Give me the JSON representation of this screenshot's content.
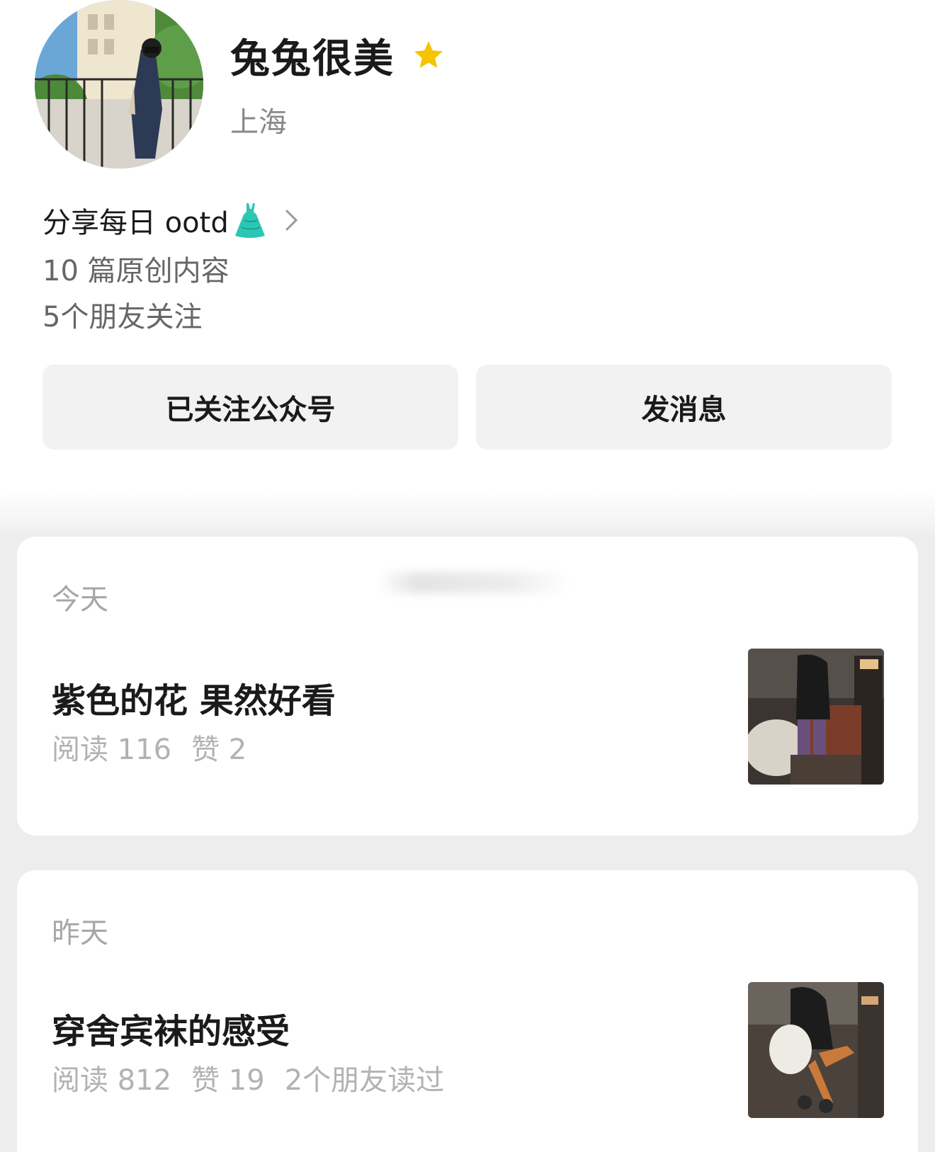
{
  "profile": {
    "name": "兔兔很美",
    "badge_icon": "star-icon",
    "location": "上海",
    "bio": "分享每日 ootd",
    "bio_emoji_icon": "dress-icon",
    "posts_count": "10 篇原创内容",
    "friends_following": "5个朋友关注"
  },
  "actions": {
    "follow_label": "已关注公众号",
    "message_label": "发消息"
  },
  "feed": [
    {
      "date": "今天",
      "title": "紫色的花 果然好看",
      "reads": "阅读 116",
      "likes": "赞 2",
      "friends_read": ""
    },
    {
      "date": "昨天",
      "title": "穿舍宾袜的感受",
      "reads": "阅读 812",
      "likes": "赞 19",
      "friends_read": "2个朋友读过"
    }
  ],
  "colors": {
    "star": "#f5c400",
    "dress": "#2bc7b5",
    "page_bg": "#ededed",
    "button_bg": "#f2f2f2"
  }
}
